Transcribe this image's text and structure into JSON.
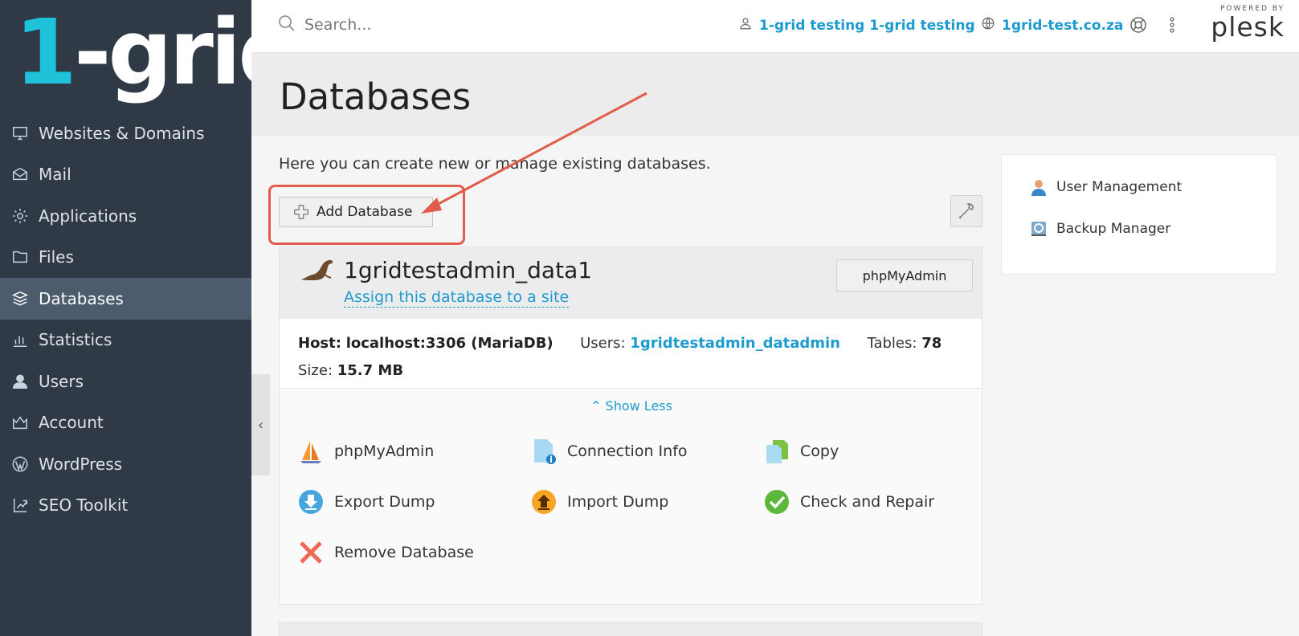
{
  "brand": {
    "logo_text_one": "1",
    "logo_text_rest": "-grid",
    "accent": "#1ec2d9",
    "sidebar_bg": "#2f3a46",
    "link": "#1d9bd1"
  },
  "sidebar": {
    "items": [
      {
        "label": "Websites & Domains",
        "icon": "monitor-icon"
      },
      {
        "label": "Mail",
        "icon": "mail-icon"
      },
      {
        "label": "Applications",
        "icon": "gear-icon"
      },
      {
        "label": "Files",
        "icon": "folder-icon"
      },
      {
        "label": "Databases",
        "icon": "database-stack-icon",
        "active": true
      },
      {
        "label": "Statistics",
        "icon": "bar-chart-icon"
      },
      {
        "label": "Users",
        "icon": "user-icon"
      },
      {
        "label": "Account",
        "icon": "account-icon"
      },
      {
        "label": "WordPress",
        "icon": "wordpress-icon"
      },
      {
        "label": "SEO Toolkit",
        "icon": "seo-icon"
      }
    ]
  },
  "topbar": {
    "search_placeholder": "Search...",
    "user_label": "1-grid testing 1-grid testing",
    "domain_label": "1grid-test.co.za",
    "plesk_powered": "POWERED BY",
    "plesk_name": "plesk"
  },
  "page": {
    "title": "Databases",
    "intro": "Here you can create new or manage existing databases.",
    "add_button": "Add Database"
  },
  "database": {
    "name": "1gridtestadmin_data1",
    "assign_link": "Assign this database to a site",
    "phpmyadmin_button": "phpMyAdmin",
    "host_label": "Host:",
    "host_value": "localhost:3306 (MariaDB)",
    "users_label": "Users:",
    "users_value": "1gridtestadmin_datadmin",
    "tables_label": "Tables:",
    "tables_value": "78",
    "size_label": "Size:",
    "size_value": "15.7 MB",
    "show_less": "Show Less",
    "actions": [
      {
        "label": "phpMyAdmin",
        "icon": "phpmyadmin-icon"
      },
      {
        "label": "Connection Info",
        "icon": "connection-info-icon"
      },
      {
        "label": "Copy",
        "icon": "copy-icon"
      },
      {
        "label": "Export Dump",
        "icon": "export-dump-icon"
      },
      {
        "label": "Import Dump",
        "icon": "import-dump-icon"
      },
      {
        "label": "Check and Repair",
        "icon": "check-repair-icon"
      },
      {
        "label": "Remove Database",
        "icon": "remove-icon"
      }
    ]
  },
  "side_panel": {
    "links": [
      {
        "label": "User Management",
        "icon": "user-management-icon"
      },
      {
        "label": "Backup Manager",
        "icon": "backup-manager-icon"
      }
    ]
  },
  "annotation_color": "#e15c4a"
}
